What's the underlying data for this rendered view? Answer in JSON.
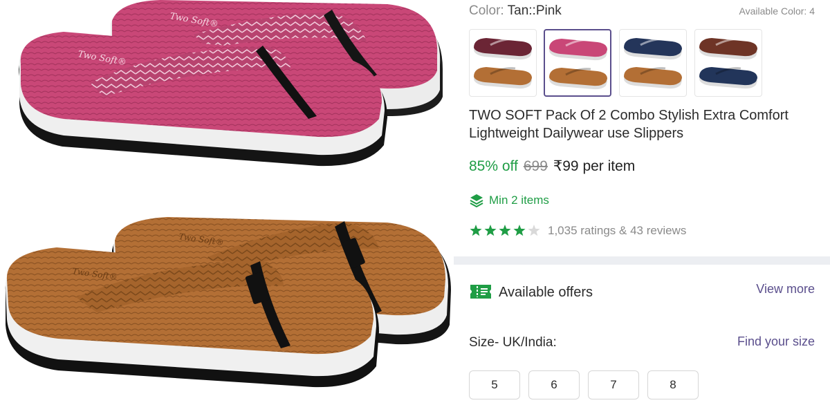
{
  "product": {
    "image_alt": "Pink and tan wedge flip-flop slippers, pack of 2",
    "brand_print": "Two Soft®"
  },
  "colors": {
    "label": "Color:",
    "selected": "Tan::Pink",
    "available_text": "Available Color: 4",
    "swatches": [
      {
        "name": "Maroon / Tan",
        "top": "#6b2535",
        "bottom": "#b36f35",
        "selected": false
      },
      {
        "name": "Pink / Tan",
        "top": "#c94777",
        "bottom": "#b36f35",
        "selected": true
      },
      {
        "name": "Navy / Tan",
        "top": "#24355a",
        "bottom": "#b36f35",
        "selected": false
      },
      {
        "name": "Brown / Navy",
        "top": "#6e3426",
        "bottom": "#22355a",
        "selected": false
      }
    ]
  },
  "title": "TWO SOFT Pack Of 2 Combo Stylish Extra Comfort Lightweight Dailywear use Slippers",
  "pricing": {
    "discount": "85% off",
    "mrp": "699",
    "price": "₹99 per item"
  },
  "min_items": {
    "icon": "layers-icon",
    "text": "Min 2 items"
  },
  "rating": {
    "stars": 4,
    "max": 5,
    "text": "1,035 ratings  & 43 reviews"
  },
  "offers": {
    "icon": "ticket-icon",
    "title": "Available offers",
    "view_more": "View more"
  },
  "size": {
    "label": "Size- UK/India:",
    "find_size": "Find your size",
    "options": [
      "5",
      "6",
      "7",
      "8"
    ]
  },
  "colors_palette": {
    "green": "#1f9d45",
    "purple": "#5a4e8c",
    "gray": "#8a8a8a",
    "pink": "#c94777",
    "tan": "#b36f35"
  }
}
